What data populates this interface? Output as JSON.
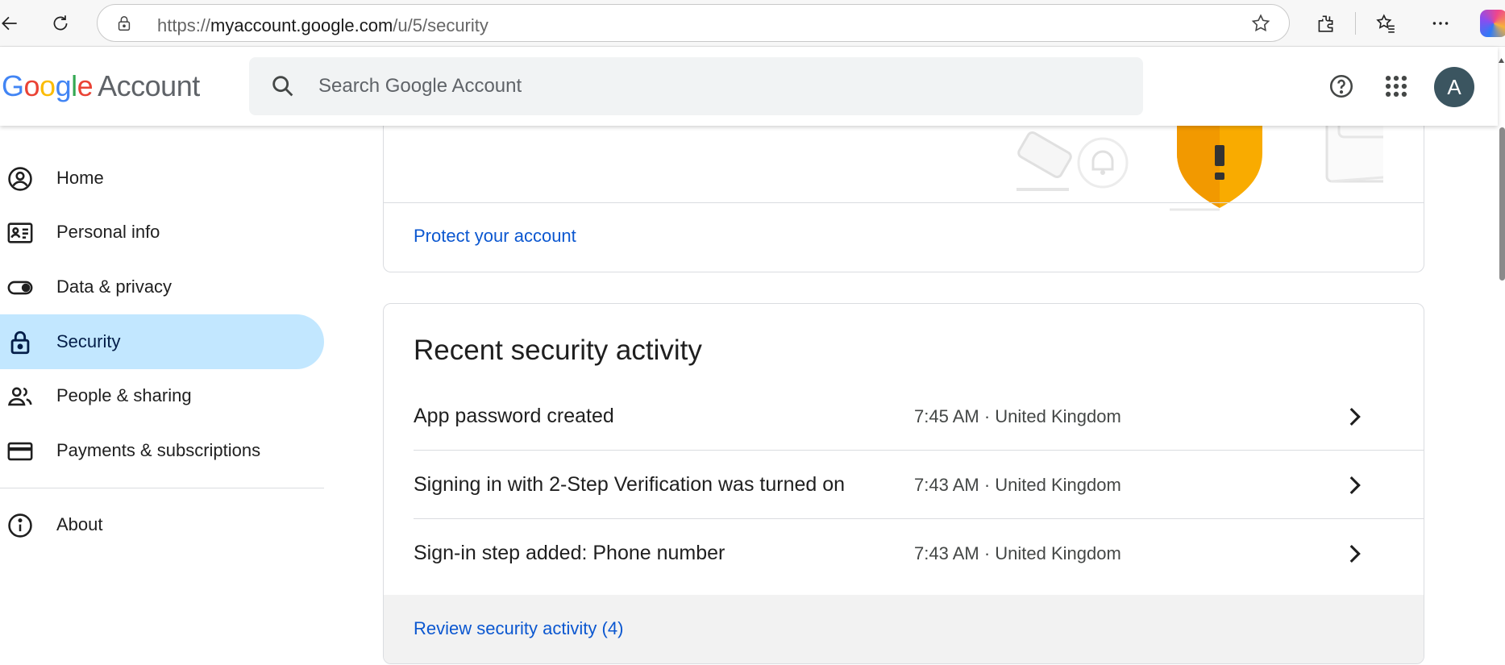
{
  "browser": {
    "url_scheme": "https://",
    "url_host": "myaccount.google.com",
    "url_path": "/u/5/security",
    "icons": [
      "back-icon",
      "refresh-icon",
      "lock-icon",
      "favorite-star-icon",
      "extensions-icon",
      "favorites-icon",
      "more-icon",
      "copilot-icon"
    ]
  },
  "header": {
    "logo_letters": [
      "G",
      "o",
      "o",
      "g",
      "l",
      "e"
    ],
    "logo_word": "Account",
    "search_placeholder": "Search Google Account",
    "avatar_initial": "A",
    "avatar_color": "#3b5560"
  },
  "sidebar": {
    "items": [
      {
        "label": "Home",
        "icon": "account-circle-icon"
      },
      {
        "label": "Personal info",
        "icon": "id-card-icon"
      },
      {
        "label": "Data & privacy",
        "icon": "toggle-icon"
      },
      {
        "label": "Security",
        "icon": "lock-icon",
        "active": true
      },
      {
        "label": "People & sharing",
        "icon": "people-icon"
      },
      {
        "label": "Payments & subscriptions",
        "icon": "credit-card-icon"
      },
      {
        "label": "About",
        "icon": "info-icon"
      }
    ]
  },
  "protect_card": {
    "link": "Protect your account"
  },
  "activity": {
    "title": "Recent security activity",
    "rows": [
      {
        "event": "App password created",
        "meta": "7:45 AM · United Kingdom"
      },
      {
        "event": "Signing in with 2-Step Verification was turned on",
        "meta": "7:43 AM · United Kingdom"
      },
      {
        "event": "Sign-in step added: Phone number",
        "meta": "7:43 AM · United Kingdom"
      }
    ],
    "review_link": "Review security activity (4)"
  },
  "colors": {
    "accent_link": "#0b57d0",
    "active_nav_bg": "#c2e7ff",
    "shield": "#f9ab00",
    "google_blue": "#4285f4",
    "google_red": "#ea4335",
    "google_yellow": "#fbbc05",
    "google_green": "#34a853"
  }
}
